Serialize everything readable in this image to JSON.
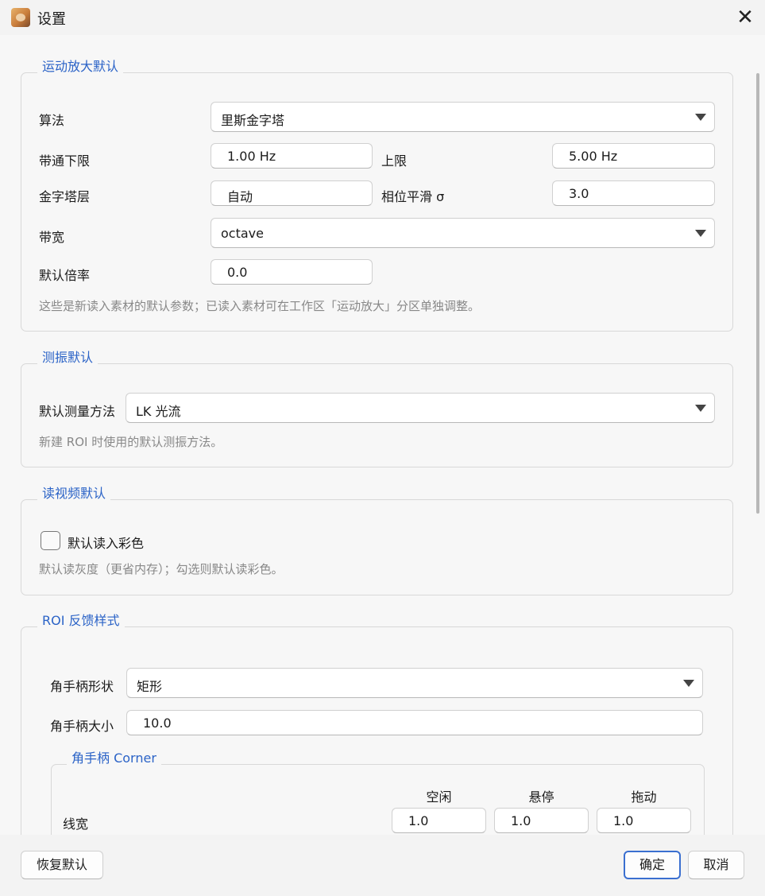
{
  "window": {
    "title": "设置",
    "icon": "app-cat-icon",
    "close_symbol": "✕"
  },
  "motion_magnification": {
    "title": "运动放大默认",
    "algorithm_label": "算法",
    "algorithm_value": "里斯金字塔",
    "bandpass_low_label": "带通下限",
    "bandpass_low_value": "1.00 Hz",
    "bandpass_high_label": "上限",
    "bandpass_high_value": "5.00 Hz",
    "pyramid_levels_label": "金字塔层",
    "pyramid_levels_value": "自动",
    "phase_smoothing_label": "相位平滑 σ",
    "phase_smoothing_value": "3.0",
    "bandwidth_label": "带宽",
    "bandwidth_value": "octave",
    "default_factor_label": "默认倍率",
    "default_factor_value": "0.0",
    "hint": "这些是新读入素材的默认参数；已读入素材可在工作区「运动放大」分区单独调整。"
  },
  "vibration": {
    "title": "测振默认",
    "method_label": "默认测量方法",
    "method_value": "LK 光流",
    "hint": "新建 ROI 时使用的默认测振方法。"
  },
  "video_reading": {
    "title": "读视频默认",
    "color_checkbox_label": "默认读入彩色",
    "color_checked": false,
    "hint": "默认读灰度（更省内存）；勾选则默认读彩色。"
  },
  "roi_style": {
    "title": "ROI 反馈样式",
    "handle_shape_label": "角手柄形状",
    "handle_shape_value": "矩形",
    "handle_size_label": "角手柄大小",
    "handle_size_value": "10.0",
    "corner": {
      "title": "角手柄 Corner",
      "columns": [
        "空闲",
        "悬停",
        "拖动"
      ],
      "line_width_label": "线宽",
      "line_width_values": [
        "1.0",
        "1.0",
        "1.0"
      ]
    }
  },
  "footer": {
    "restore_defaults": "恢复默认",
    "ok": "确定",
    "cancel": "取消"
  },
  "colors": {
    "accent": "#2b63c7",
    "hint": "#888888"
  }
}
